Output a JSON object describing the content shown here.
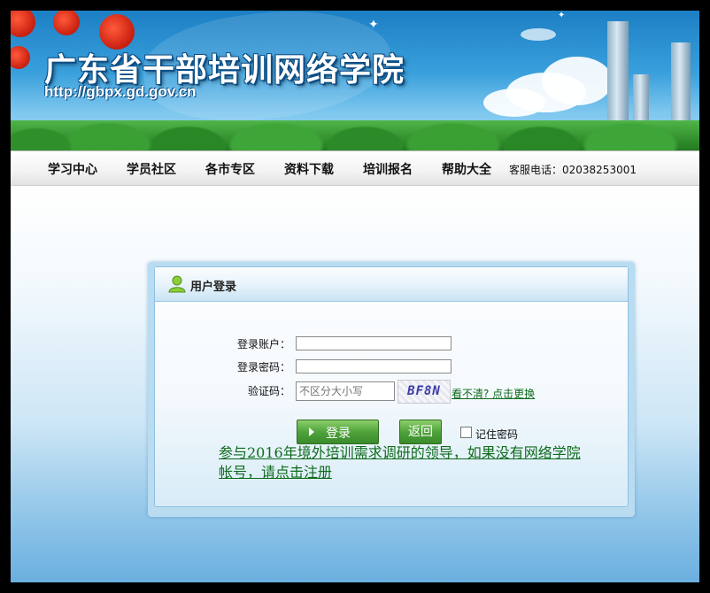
{
  "site": {
    "title": "广东省干部培训网络学院",
    "url": "http://gbpx.gd.gov.cn"
  },
  "nav": {
    "items": [
      "学习中心",
      "学员社区",
      "各市专区",
      "资料下载",
      "培训报名",
      "帮助大全"
    ],
    "hotline": "客服电话：02038253001"
  },
  "login": {
    "title": "用户登录",
    "account_label": "登录账户：",
    "account_value": "",
    "password_label": "登录密码：",
    "password_value": "",
    "captcha_label": "验证码：",
    "captcha_placeholder": "不区分大小写",
    "captcha_text": "BF8N",
    "refresh_link": "看不清? 点击更换",
    "login_button": "登录",
    "back_button": "返回",
    "remember_label": "记住密码",
    "remember_checked": false,
    "register_notice": "参与2016年境外培训需求调研的领导，如果没有网络学院帐号，请点击注册"
  },
  "colors": {
    "accent_green": "#4fa33a",
    "link_green": "#0e6b1c",
    "banner_blue": "#1c7fc4"
  }
}
